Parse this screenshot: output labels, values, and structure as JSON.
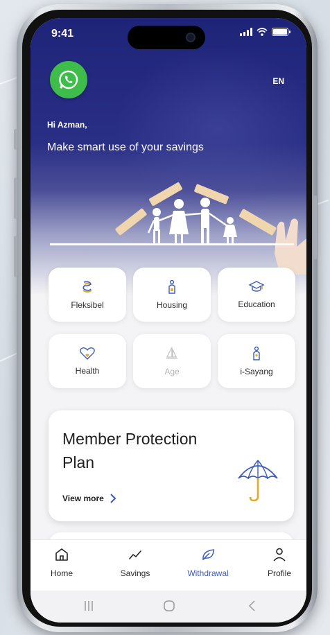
{
  "status_bar": {
    "time": "9:41"
  },
  "header": {
    "language": "EN",
    "greeting": "Hi Azman,",
    "subtitle": "Make smart use of your savings"
  },
  "categories": [
    {
      "label": "Fleksibel",
      "icon": "flexible-coins-icon",
      "enabled": true
    },
    {
      "label": "Housing",
      "icon": "housing-icon",
      "enabled": true
    },
    {
      "label": "Education",
      "icon": "graduation-cap-icon",
      "enabled": true
    },
    {
      "label": "Health",
      "icon": "heart-icon",
      "enabled": true
    },
    {
      "label": "Age",
      "icon": "sailboat-icon",
      "enabled": false
    },
    {
      "label": "i-Sayang",
      "icon": "person-icon",
      "enabled": true
    }
  ],
  "promo_card": {
    "title": "Member Protection Plan",
    "link": "View more",
    "icon": "umbrella-icon"
  },
  "bottom_nav": {
    "items": [
      {
        "label": "Home",
        "icon": "home-icon"
      },
      {
        "label": "Savings",
        "icon": "trend-line-icon"
      },
      {
        "label": "Withdrawal",
        "icon": "leaf-icon"
      },
      {
        "label": "Profile",
        "icon": "profile-icon"
      }
    ],
    "active": "Withdrawal"
  },
  "colors": {
    "hero_navy": "#1e2478",
    "accent_blue": "#3a5bbd",
    "accent_gold": "#e0ac2c",
    "whatsapp_green": "#3fbd4a"
  }
}
